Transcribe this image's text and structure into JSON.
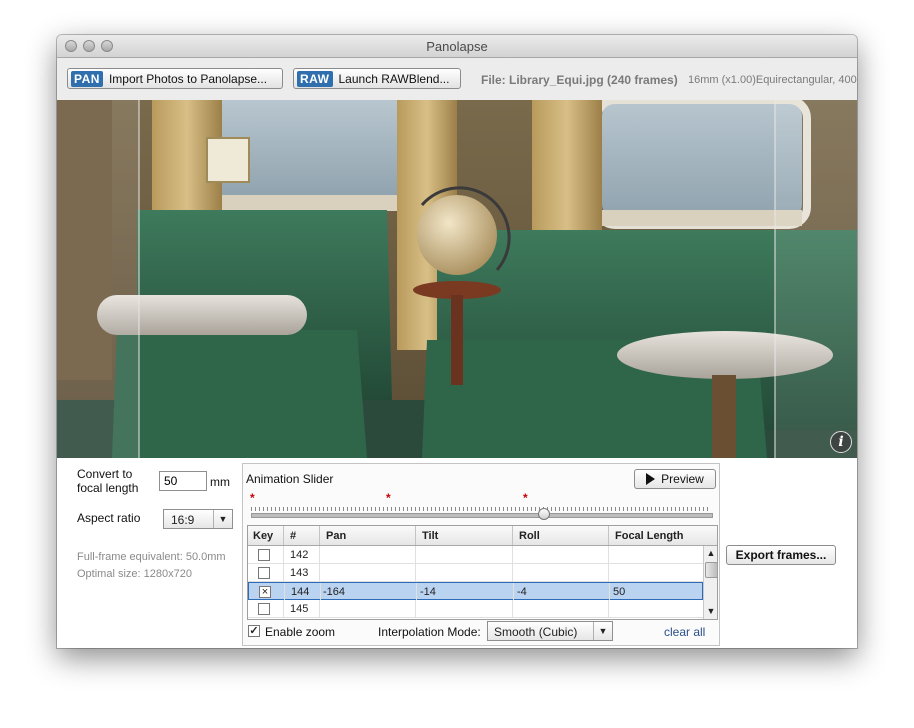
{
  "window": {
    "title": "Panolapse"
  },
  "toolbar": {
    "import_badge": "PAN",
    "import_label": "Import Photos to Panolapse...",
    "raw_badge": "RAW",
    "raw_label": "Launch RAWBlend...",
    "file_info": "File: Library_Equi.jpg (240 frames)",
    "file_details": "16mm (x1.00)Equirectangular, 400"
  },
  "settings": {
    "convert_label_1": "Convert to",
    "convert_label_2": "focal length",
    "focal_value": "50",
    "focal_unit": "mm",
    "aspect_label": "Aspect ratio",
    "aspect_value": "16:9",
    "fullframe_text": "Full-frame equivalent: 50.0mm",
    "optimal_text": "Optimal size: 1280x720"
  },
  "animation": {
    "title": "Animation Slider",
    "preview_label": "Preview",
    "slider_value": 0.64,
    "keyframe_markers": [
      "*",
      "*",
      "*"
    ],
    "columns": [
      "Key",
      "#",
      "Pan",
      "Tilt",
      "Roll",
      "Focal Length"
    ],
    "rows": [
      {
        "key": false,
        "num": "142",
        "pan": "",
        "tilt": "",
        "roll": "",
        "focal": ""
      },
      {
        "key": false,
        "num": "143",
        "pan": "",
        "tilt": "",
        "roll": "",
        "focal": ""
      },
      {
        "key": true,
        "num": "144",
        "pan": "-164",
        "tilt": "-14",
        "roll": "-4",
        "focal": "50"
      },
      {
        "key": false,
        "num": "145",
        "pan": "",
        "tilt": "",
        "roll": "",
        "focal": ""
      }
    ],
    "enable_zoom_label": "Enable zoom",
    "enable_zoom_checked": true,
    "interp_label": "Interpolation Mode:",
    "interp_value": "Smooth (Cubic)",
    "clear_all_label": "clear all"
  },
  "export": {
    "label": "Export frames..."
  },
  "info_icon": "info-icon"
}
